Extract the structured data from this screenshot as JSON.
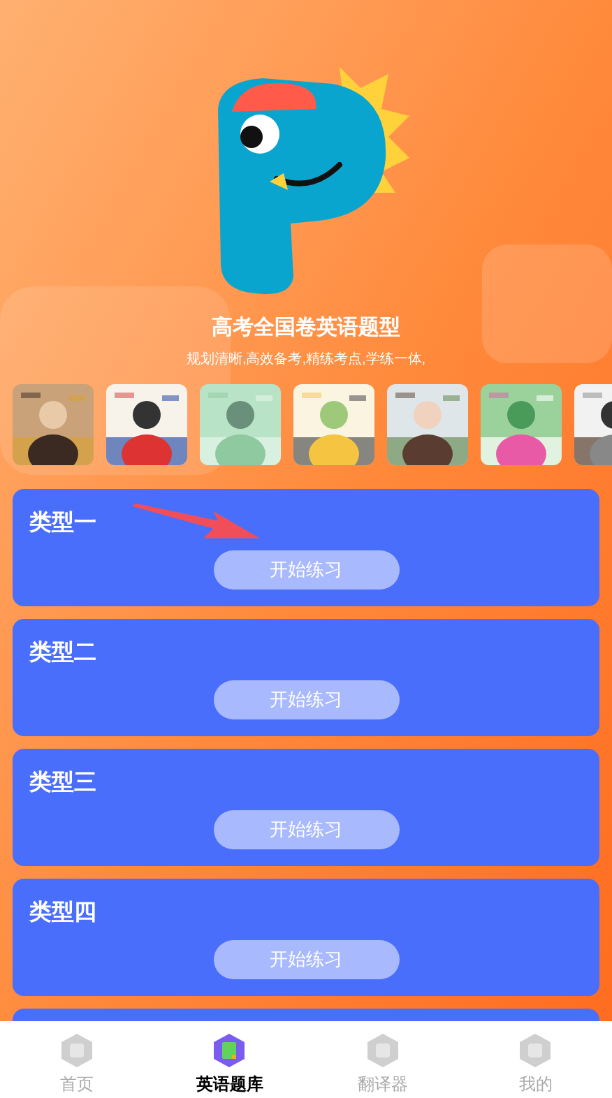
{
  "header": {
    "title": "高考全国卷英语题型",
    "subtitle": "规划清晰,高效备考,精练考点,学练一体,"
  },
  "cards": [
    {
      "title": "类型一",
      "button": "开始练习"
    },
    {
      "title": "类型二",
      "button": "开始练习"
    },
    {
      "title": "类型三",
      "button": "开始练习"
    },
    {
      "title": "类型四",
      "button": "开始练习"
    }
  ],
  "tab_bar": [
    {
      "label": "首页",
      "selected": false
    },
    {
      "label": "英语题库",
      "selected": true
    },
    {
      "label": "翻译器",
      "selected": false
    },
    {
      "label": "我的",
      "selected": false
    }
  ]
}
